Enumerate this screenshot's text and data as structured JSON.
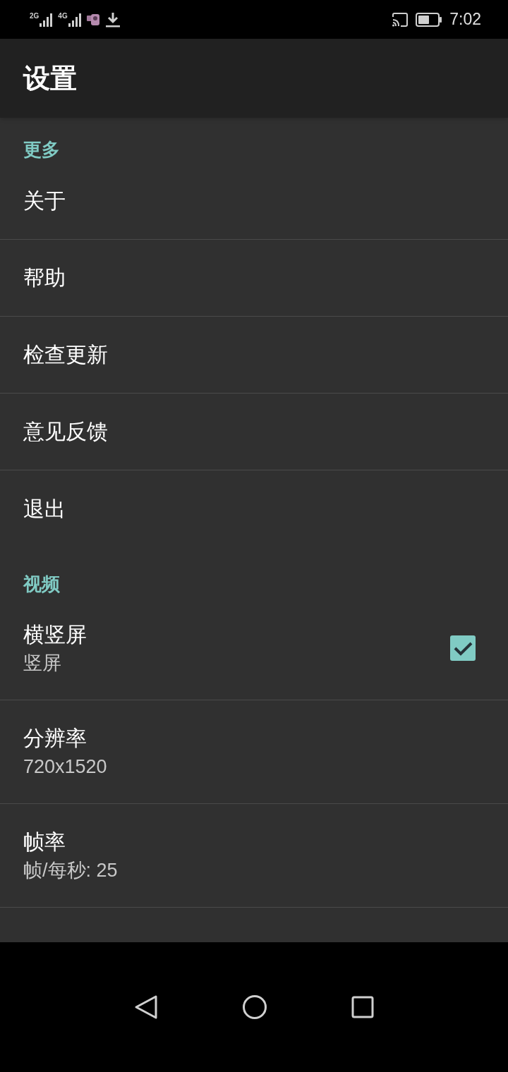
{
  "status_bar": {
    "networks": [
      "2G",
      "4G"
    ],
    "time": "7:02"
  },
  "app_bar": {
    "title": "设置"
  },
  "sections": [
    {
      "header": "更多",
      "items": [
        {
          "kind": "plain",
          "title": "关于"
        },
        {
          "kind": "plain",
          "title": "帮助"
        },
        {
          "kind": "plain",
          "title": "检查更新"
        },
        {
          "kind": "plain",
          "title": "意见反馈"
        },
        {
          "kind": "plain",
          "title": "退出"
        }
      ]
    },
    {
      "header": "视频",
      "items": [
        {
          "kind": "checkbox",
          "title": "横竖屏",
          "summary": "竖屏",
          "checked": true
        },
        {
          "kind": "plain",
          "title": "分辨率",
          "summary": "720x1520"
        },
        {
          "kind": "plain",
          "title": "帧率",
          "summary": "帧/每秒: 25"
        }
      ]
    }
  ]
}
